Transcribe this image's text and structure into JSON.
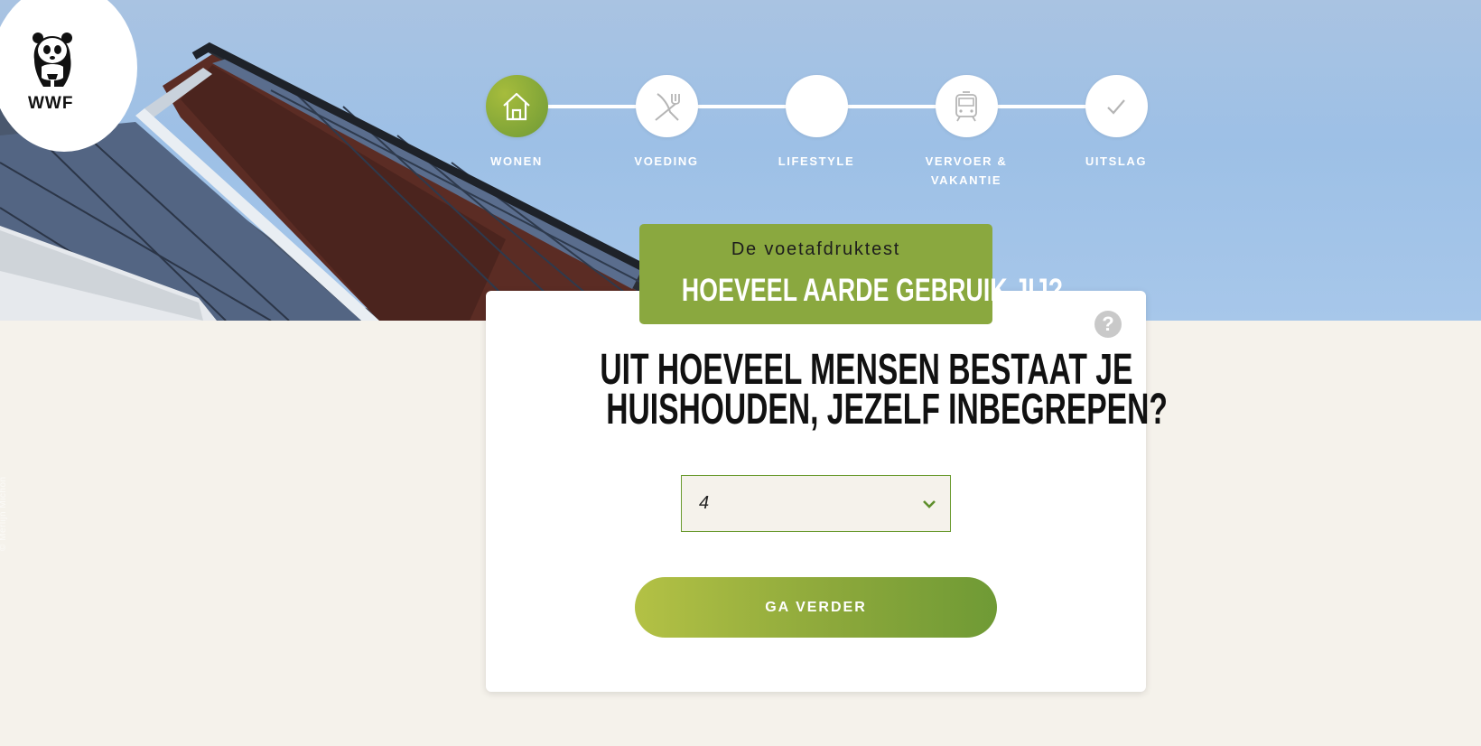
{
  "brand": {
    "name": "WWF"
  },
  "photo_credit": "© Merlijn Michon",
  "steps": [
    {
      "label": "WONEN",
      "icon": "house-icon",
      "active": true
    },
    {
      "label": "VOEDING",
      "icon": "cutlery-icon",
      "active": false
    },
    {
      "label": "LIFESTYLE",
      "icon": "",
      "active": false
    },
    {
      "label": "VERVOER & VAKANTIE",
      "icon": "train-icon",
      "active": false
    },
    {
      "label": "UITSLAG",
      "icon": "check-icon",
      "active": false
    }
  ],
  "header": {
    "kicker": "De voetafdruktest",
    "title": "HOEVEEL AARDE GEBRUIK JIJ?"
  },
  "question": {
    "line1": "UIT HOEVEEL MENSEN BESTAAT JE",
    "line2": "HUISHOUDEN, JEZELF INBEGREPEN?"
  },
  "select": {
    "value": "4"
  },
  "cta": {
    "label": "GA VERDER"
  },
  "help_icon": "?",
  "colors": {
    "accent": "#8aa83f",
    "accent_dark": "#6f9a35",
    "background": "#f5f2eb"
  }
}
